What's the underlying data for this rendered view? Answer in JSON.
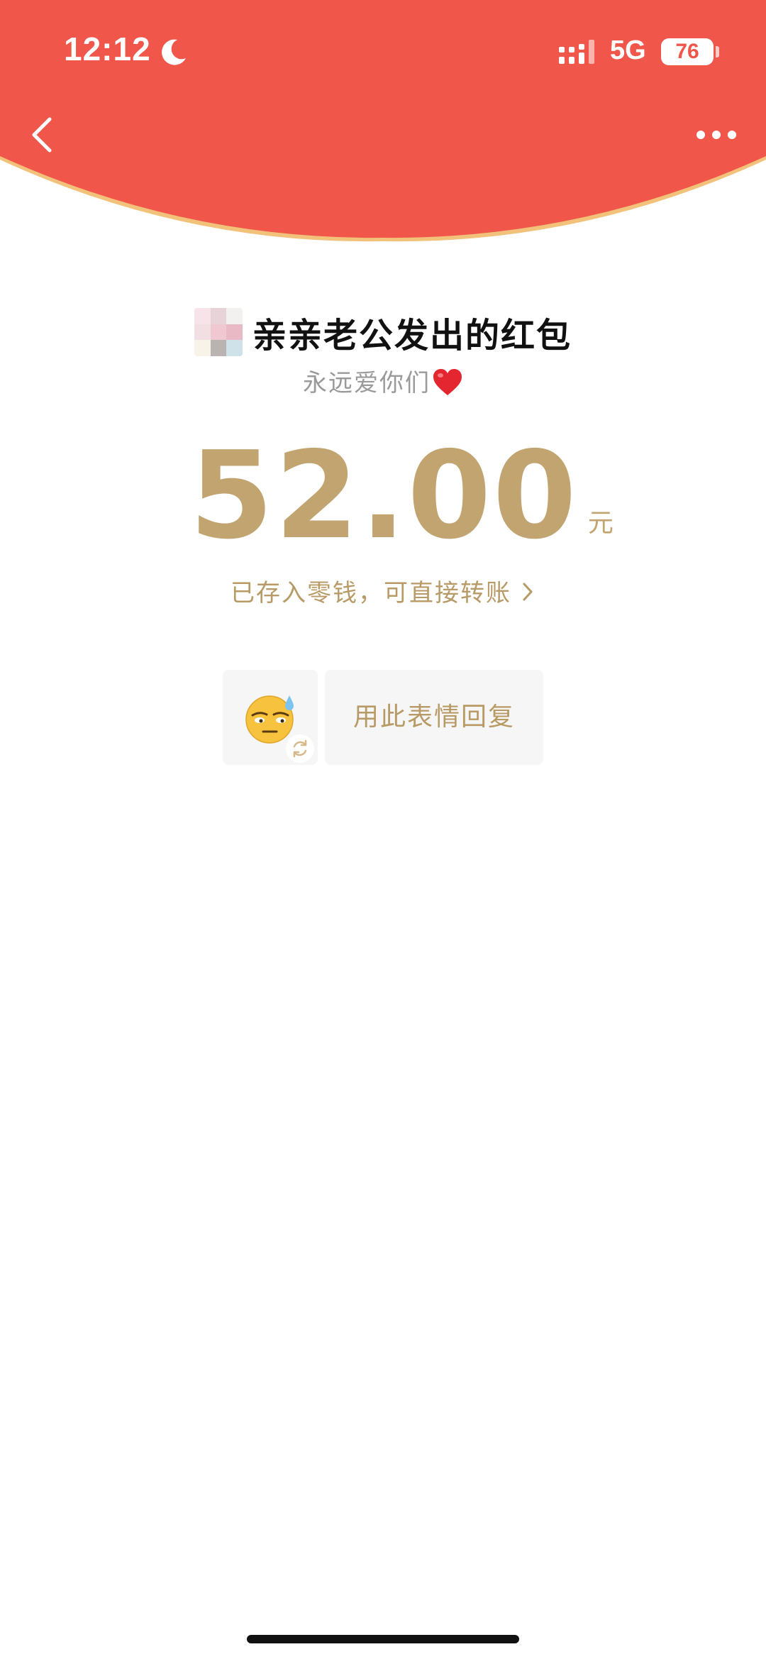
{
  "colors": {
    "header_red": "#f0574a",
    "header_edge": "#f3c27a",
    "gold": "#c2a470",
    "gold_text": "#b89a66",
    "card_bg": "#f6f6f6"
  },
  "status_bar": {
    "time": "12:12",
    "network": "5G",
    "battery": "76",
    "icons": [
      "moon-icon",
      "signal-icon"
    ]
  },
  "nav": {
    "back_icon": "chevron-left-icon",
    "more_icon": "more-dots-icon"
  },
  "packet": {
    "sender_title": "亲亲老公发出的红包",
    "blessing": "永远爱你们",
    "blessing_emoji": "heart-icon",
    "amount": "52.00",
    "unit": "元",
    "deposit_text": "已存入零钱，可直接转账"
  },
  "reply": {
    "sticker_icon": "sweat-smile-emoji-icon",
    "refresh_icon": "refresh-icon",
    "reply_label": "用此表情回复"
  }
}
